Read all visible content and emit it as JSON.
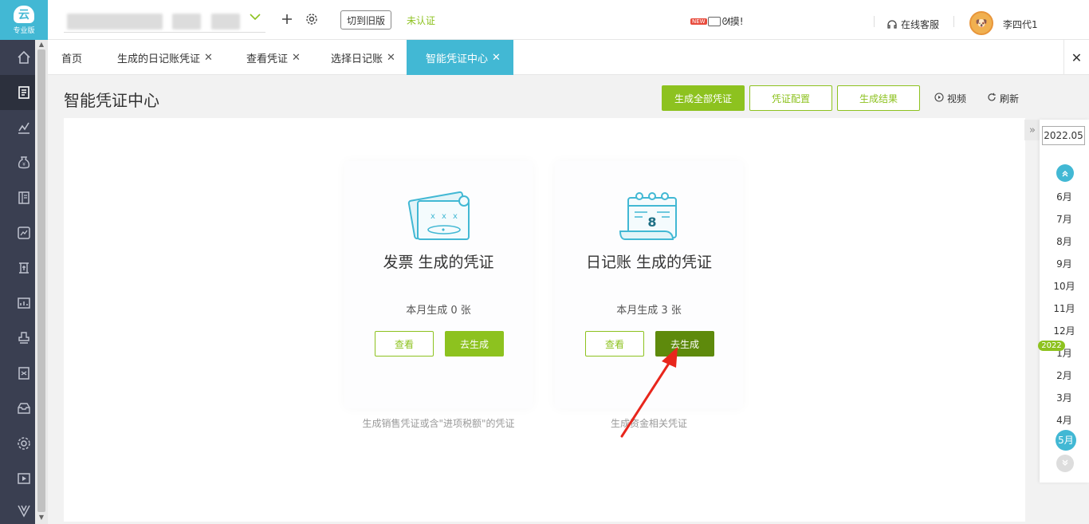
{
  "brand": {
    "logo_mark": "云",
    "edition": "专业版"
  },
  "topbar": {
    "add_icon": "plus-icon",
    "settings_icon": "gear-icon",
    "switch_old": "切到旧版",
    "verification_status": "未认证",
    "news_badge": "NEW",
    "news_text": "ᘛ摸!",
    "customer_service": "在线客服",
    "username": "李四代1"
  },
  "rail": {
    "items": [
      "home-icon",
      "voucher-icon",
      "chart-icon",
      "money-bag-icon",
      "book-icon",
      "report-icon",
      "tax-icon",
      "asset-icon",
      "stamp-icon",
      "invoice-icon",
      "archive-icon",
      "settings-icon",
      "video-icon",
      "vip-icon"
    ]
  },
  "tabs": [
    {
      "label": "首页"
    },
    {
      "label": "生成的日记账凭证"
    },
    {
      "label": "查看凭证"
    },
    {
      "label": "选择日记账"
    },
    {
      "label": "智能凭证中心"
    }
  ],
  "page": {
    "title": "智能凭证中心",
    "btn_generate_all": "生成全部凭证",
    "btn_config": "凭证配置",
    "btn_results": "生成结果",
    "link_video": "视频",
    "link_refresh": "刷新"
  },
  "cards": [
    {
      "title": "发票 生成的凭证",
      "count_text": "本月生成 0 张",
      "view": "查看",
      "go": "去生成",
      "desc": "生成销售凭证或含\"进项税额\"的凭证",
      "icon": "invoice-ticket-icon"
    },
    {
      "title": "日记账 生成的凭证",
      "count_text": "本月生成 3 张",
      "view": "查看",
      "go": "去生成",
      "desc": "生成资金相关凭证",
      "icon": "calendar-journal-icon"
    }
  ],
  "periods": {
    "current": "2022.05",
    "months": [
      "6月",
      "7月",
      "8月",
      "9月",
      "10月",
      "11月",
      "12月",
      "1月",
      "2月",
      "3月",
      "4月",
      "5月"
    ],
    "year_tag": "2022",
    "active_month": "5月"
  },
  "colors": {
    "accent_green": "#8dc21f",
    "dark_green": "#5e8a0c",
    "accent_teal": "#42b8d4",
    "rail_bg": "#3a3f51",
    "annotation_red": "#e8261c"
  }
}
